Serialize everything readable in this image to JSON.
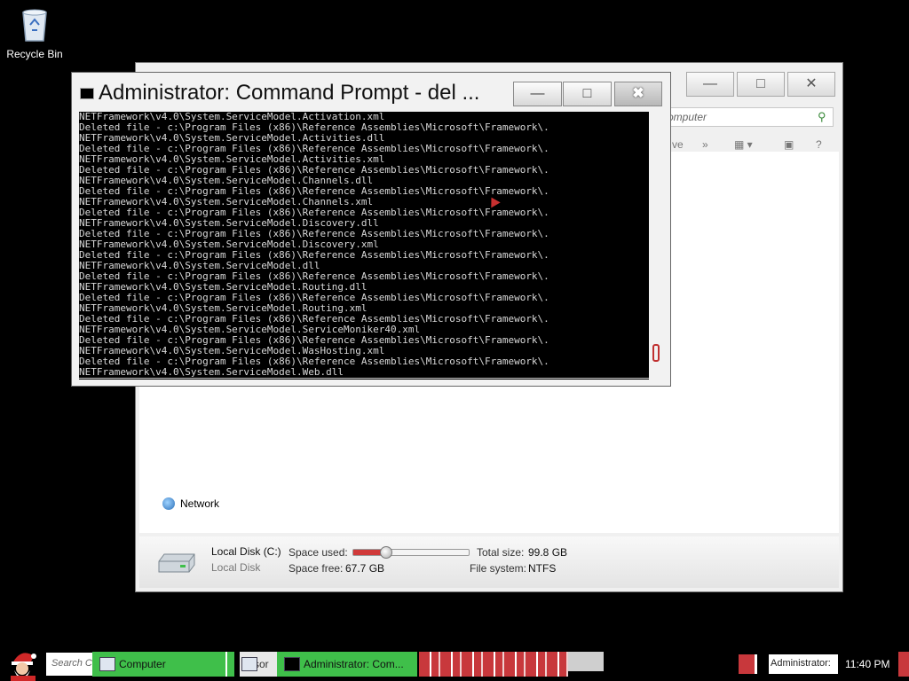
{
  "desktop": {
    "icons": [
      {
        "label": "Recycle Bin",
        "icon": "recycle-bin-icon"
      }
    ]
  },
  "explorer": {
    "address_text": "omputer",
    "toolbar": {
      "view_label": "ve",
      "more_label": "»",
      "help_label": "?"
    },
    "nav_items": [
      {
        "label": "Network",
        "icon": "network-icon"
      }
    ],
    "details": {
      "drive_name": "Local Disk (C:)",
      "drive_type": "Local Disk",
      "space_used_label": "Space used:",
      "space_free_label": "Space free:",
      "space_free_value": "67.7 GB",
      "total_size_label": "Total size:",
      "total_size_value": "99.8 GB",
      "file_system_label": "File system:",
      "file_system_value": "NTFS",
      "used_fraction": 0.28
    }
  },
  "cmd": {
    "title": "Administrator: Command Prompt - del ...",
    "lines": [
      "NETFramework\\v4.0\\System.ServiceModel.Activation.xml",
      "Deleted file - c:\\Program Files (x86)\\Reference Assemblies\\Microsoft\\Framework\\.",
      "NETFramework\\v4.0\\System.ServiceModel.Activities.dll",
      "Deleted file - c:\\Program Files (x86)\\Reference Assemblies\\Microsoft\\Framework\\.",
      "NETFramework\\v4.0\\System.ServiceModel.Activities.xml",
      "Deleted file - c:\\Program Files (x86)\\Reference Assemblies\\Microsoft\\Framework\\.",
      "NETFramework\\v4.0\\System.ServiceModel.Channels.dll",
      "Deleted file - c:\\Program Files (x86)\\Reference Assemblies\\Microsoft\\Framework\\.",
      "NETFramework\\v4.0\\System.ServiceModel.Channels.xml",
      "Deleted file - c:\\Program Files (x86)\\Reference Assemblies\\Microsoft\\Framework\\.",
      "NETFramework\\v4.0\\System.ServiceModel.Discovery.dll",
      "Deleted file - c:\\Program Files (x86)\\Reference Assemblies\\Microsoft\\Framework\\.",
      "NETFramework\\v4.0\\System.ServiceModel.Discovery.xml",
      "Deleted file - c:\\Program Files (x86)\\Reference Assemblies\\Microsoft\\Framework\\.",
      "NETFramework\\v4.0\\System.ServiceModel.dll",
      "Deleted file - c:\\Program Files (x86)\\Reference Assemblies\\Microsoft\\Framework\\.",
      "NETFramework\\v4.0\\System.ServiceModel.Routing.dll",
      "Deleted file - c:\\Program Files (x86)\\Reference Assemblies\\Microsoft\\Framework\\.",
      "NETFramework\\v4.0\\System.ServiceModel.Routing.xml",
      "Deleted file - c:\\Program Files (x86)\\Reference Assemblies\\Microsoft\\Framework\\.",
      "NETFramework\\v4.0\\System.ServiceModel.ServiceMoniker40.xml",
      "Deleted file - c:\\Program Files (x86)\\Reference Assemblies\\Microsoft\\Framework\\.",
      "NETFramework\\v4.0\\System.ServiceModel.WasHosting.xml",
      "Deleted file - c:\\Program Files (x86)\\Reference Assemblies\\Microsoft\\Framework\\.",
      "NETFramework\\v4.0\\System.ServiceModel.Web.dll"
    ]
  },
  "taskbar": {
    "search_placeholder": "Search C",
    "tasks": [
      {
        "label": "Computer",
        "icon": "computer-icon"
      },
      {
        "label": "sor",
        "icon": "window-icon"
      },
      {
        "label": "Administrator: Com...",
        "icon": "cmd-icon"
      }
    ],
    "tray_text": "Administrator:",
    "clock": "11:40 PM"
  },
  "colors": {
    "task_green": "#3fbf4a",
    "task_red": "#c8383c",
    "console_bg": "#000000",
    "console_text": "#d8d8d8"
  }
}
